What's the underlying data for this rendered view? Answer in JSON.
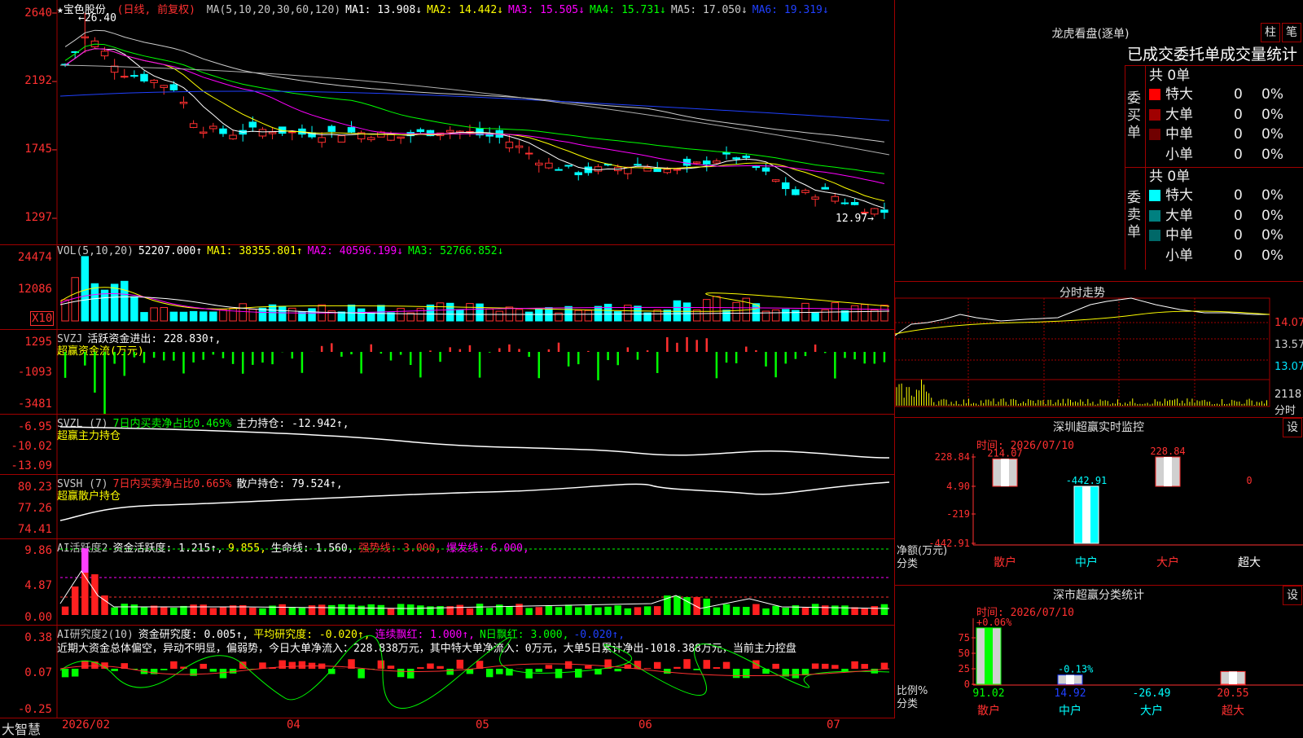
{
  "stock": {
    "name": "★宝色股份",
    "mode": "(日线, 前复权)",
    "ma_header": [
      {
        "t": "MA(5,10,20,30,60,120)",
        "c": "#c8c8c8"
      },
      {
        "t": "MA1: 13.908↓",
        "c": "#ffffff"
      },
      {
        "t": "MA2: 14.442↓",
        "c": "#ffff00"
      },
      {
        "t": "MA3: 15.505↓",
        "c": "#ff00ff"
      },
      {
        "t": "MA4: 15.731↓",
        "c": "#00ff00"
      },
      {
        "t": "MA5: 17.050↓",
        "c": "#cccccc"
      },
      {
        "t": "MA6: 19.319↓",
        "c": "#2040ff"
      }
    ],
    "high_label": "←26.40",
    "low_label": "12.97→",
    "y_labels": [
      "2640",
      "2192",
      "1745",
      "1297"
    ]
  },
  "vol": {
    "header": [
      {
        "t": "VOL(5,10,20)",
        "c": "#c8c8c8"
      },
      {
        "t": "52207.000↑",
        "c": "#ffffff"
      },
      {
        "t": "MA1: 38355.801↑",
        "c": "#ffff00"
      },
      {
        "t": "MA2: 40596.199↓",
        "c": "#ff00ff"
      },
      {
        "t": "MA3: 52766.852↓",
        "c": "#00ff00"
      }
    ],
    "y_labels": [
      "24474",
      "12086"
    ],
    "unit": "X10"
  },
  "svzj": {
    "header": [
      {
        "t": "SVZJ",
        "c": "#c8c8c8"
      },
      {
        "t": "活跃资金进出: 228.830↑,",
        "c": "#ffffff"
      }
    ],
    "sub": "超赢资金流(万元)",
    "y_labels": [
      "1295",
      "-1093",
      "-3481"
    ]
  },
  "svzl": {
    "header": [
      {
        "t": "SVZL (7)",
        "c": "#c8c8c8"
      },
      {
        "t": "7日内买卖净占比0.469%",
        "c": "#00ff00"
      },
      {
        "t": "主力持仓: -12.942↑,",
        "c": "#ffffff"
      }
    ],
    "sub": "超赢主力持仓",
    "y_labels": [
      "-6.95",
      "-10.02",
      "-13.09"
    ]
  },
  "svsh": {
    "header": [
      {
        "t": "SVSH (7)",
        "c": "#c8c8c8"
      },
      {
        "t": "7日内买卖净占比0.665%",
        "c": "#ff3030"
      },
      {
        "t": "散户持仓: 79.524↑,",
        "c": "#ffffff"
      }
    ],
    "sub": "超赢散户持仓",
    "y_labels": [
      "80.23",
      "77.26",
      "74.41"
    ]
  },
  "aihy": {
    "header": [
      {
        "t": "AI活跃度2",
        "c": "#c8c8c8"
      },
      {
        "t": "资金活跃度: 1.215↑,",
        "c": "#ffffff"
      },
      {
        "t": "9.855,",
        "c": "#ffff00"
      },
      {
        "t": "生命线: 1.560,",
        "c": "#ffffff"
      },
      {
        "t": "强势线: 3.000,",
        "c": "#ff3030"
      },
      {
        "t": "爆发线: 6.000,",
        "c": "#ff00ff"
      }
    ],
    "y_labels": [
      "9.86",
      "4.87",
      "0.00"
    ]
  },
  "aiyj": {
    "header": [
      {
        "t": "AI研究度2(10)",
        "c": "#c8c8c8"
      },
      {
        "t": "资金研究度: 0.005↑,",
        "c": "#ffffff"
      },
      {
        "t": "平均研究度: -0.020↑,",
        "c": "#ffff00"
      },
      {
        "t": "连续飘红: 1.000↑,",
        "c": "#ff00ff"
      },
      {
        "t": "N日飘红: 3.000,",
        "c": "#00ff00"
      },
      {
        "t": "-0.020↑,",
        "c": "#2040ff"
      }
    ],
    "comment": "近期大资金总体偏空，异动不明显，偏弱势，今日大单净流入：228.838万元，其中特大单净流入：0万元，大单5日累计净出-1018.388万元，当前主力控盘",
    "y_labels": [
      "0.38",
      "0.07",
      "-0.25"
    ]
  },
  "xaxis": {
    "app": "大智慧",
    "labels": [
      "2026/02",
      "04",
      "05",
      "06",
      "07"
    ]
  },
  "lhb": {
    "title": "龙虎看盘(逐单)",
    "btn1": "柱",
    "btn2": "笔",
    "subtitle": "已成交委托单成交量统计",
    "buy_group": "委买单",
    "sell_group": "委卖单",
    "buy_total": "共 0单",
    "sell_total": "共 0单",
    "buy_rows": [
      {
        "label": "特大",
        "num": "0",
        "pct": "0%",
        "color": "#ff0000"
      },
      {
        "label": "大单",
        "num": "0",
        "pct": "0%",
        "color": "#a00000"
      },
      {
        "label": "中单",
        "num": "0",
        "pct": "0%",
        "color": "#700000"
      },
      {
        "label": "小单",
        "num": "0",
        "pct": "0%",
        "color": "#000000"
      }
    ],
    "sell_rows": [
      {
        "label": "特大",
        "num": "0",
        "pct": "0%",
        "color": "#00ffff"
      },
      {
        "label": "大单",
        "num": "0",
        "pct": "0%",
        "color": "#008080"
      },
      {
        "label": "中单",
        "num": "0",
        "pct": "0%",
        "color": "#006868"
      },
      {
        "label": "小单",
        "num": "0",
        "pct": "0%",
        "color": "#000000"
      }
    ]
  },
  "fenshi": {
    "title": "分时走势",
    "prices": [
      "14.07",
      "13.57",
      "13.07"
    ],
    "vol_label": "2118",
    "unit": "分时"
  },
  "szjk": {
    "title": "深圳超赢实时监控",
    "btn": "设",
    "time": "时间: 2026/07/10",
    "y_labels": [
      "228.84",
      "4.90",
      "-219",
      "-442.91"
    ],
    "unit1": "净额(万元)",
    "unit2": "分类",
    "bars": [
      {
        "cat": "散户",
        "value": 214.07,
        "label": "214.07"
      },
      {
        "cat": "中户",
        "value": -442.91,
        "label": "-442.91"
      },
      {
        "cat": "大户",
        "value": 228.84,
        "label": "228.84"
      },
      {
        "cat": "超大",
        "value": 0,
        "label": "0"
      }
    ]
  },
  "fltj": {
    "title": "深市超赢分类统计",
    "btn": "设",
    "time": "时间: 2026/07/10",
    "y_labels": [
      "75",
      "50",
      "25",
      "0"
    ],
    "unit1": "比例%",
    "unit2": "分类",
    "bars": [
      {
        "cat": "散户",
        "value": 91.02,
        "label": "91.02",
        "chg": "+0.06%"
      },
      {
        "cat": "中户",
        "value": 14.92,
        "label": "14.92",
        "chg": "-0.13%"
      },
      {
        "cat": "大户",
        "value": -26.49,
        "label": "-26.49",
        "chg": ""
      },
      {
        "cat": "超大",
        "value": 20.55,
        "label": "20.55",
        "chg": ""
      }
    ]
  }
}
